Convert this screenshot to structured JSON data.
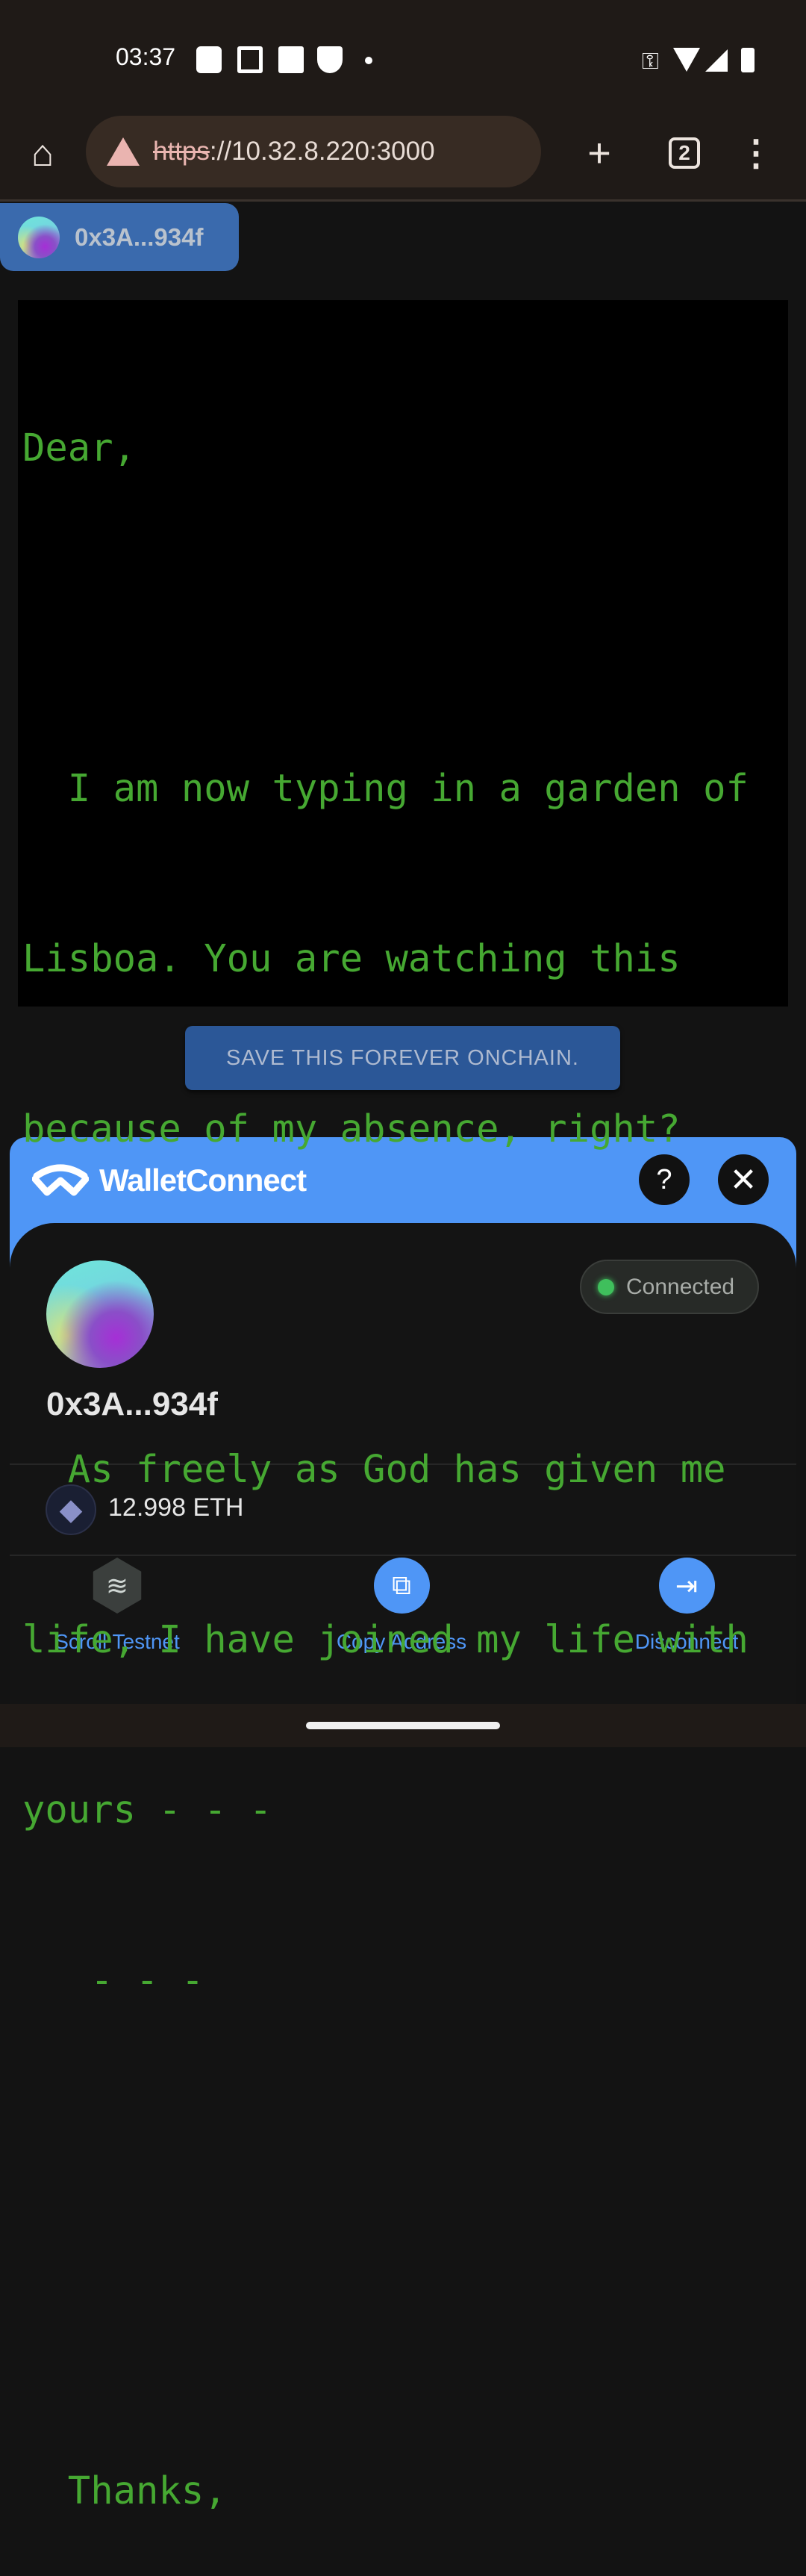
{
  "status_bar": {
    "time": "03:37",
    "icons": [
      "location-icon",
      "cast-icon",
      "vpn-app-icon",
      "shield-icon",
      "dot-icon",
      "key-icon",
      "wifi-icon",
      "signal-roaming-icon",
      "battery-icon"
    ]
  },
  "browser": {
    "url_scheme": "https",
    "url_rest": "://10.32.8.220:3000",
    "tab_count": "2",
    "icons": [
      "home-icon",
      "warning-icon",
      "plus-icon",
      "tabs-icon",
      "more-icon"
    ]
  },
  "account_button": {
    "label": "0x3A...934f"
  },
  "letter": {
    "lines": [
      "Dear,",
      "",
      "  I am now typing in a garden of",
      "Lisboa. You are watching this",
      "because of my absence, right?",
      "",
      "  As freely as God has given me",
      "life, I have joined my life with",
      "yours - - -",
      "   - - -",
      "",
      "",
      "  Thanks,"
    ]
  },
  "save_button": {
    "label": "SAVE THIS FOREVER ONCHAIN."
  },
  "modal": {
    "brand": "WalletConnect",
    "help_label": "?",
    "status": "Connected",
    "address": "0x3A...934f",
    "balance": "12.998 ETH",
    "actions": [
      {
        "label": "Scroll Testnet",
        "icon": "layers-icon"
      },
      {
        "label": "Copy Address",
        "icon": "copy-icon"
      },
      {
        "label": "Disconnect",
        "icon": "logout-icon"
      }
    ]
  },
  "colors": {
    "accent": "#4f96f6",
    "letter_text": "#46a832",
    "save_button": "#2b5797",
    "connected_dot": "#3fbf5c"
  }
}
